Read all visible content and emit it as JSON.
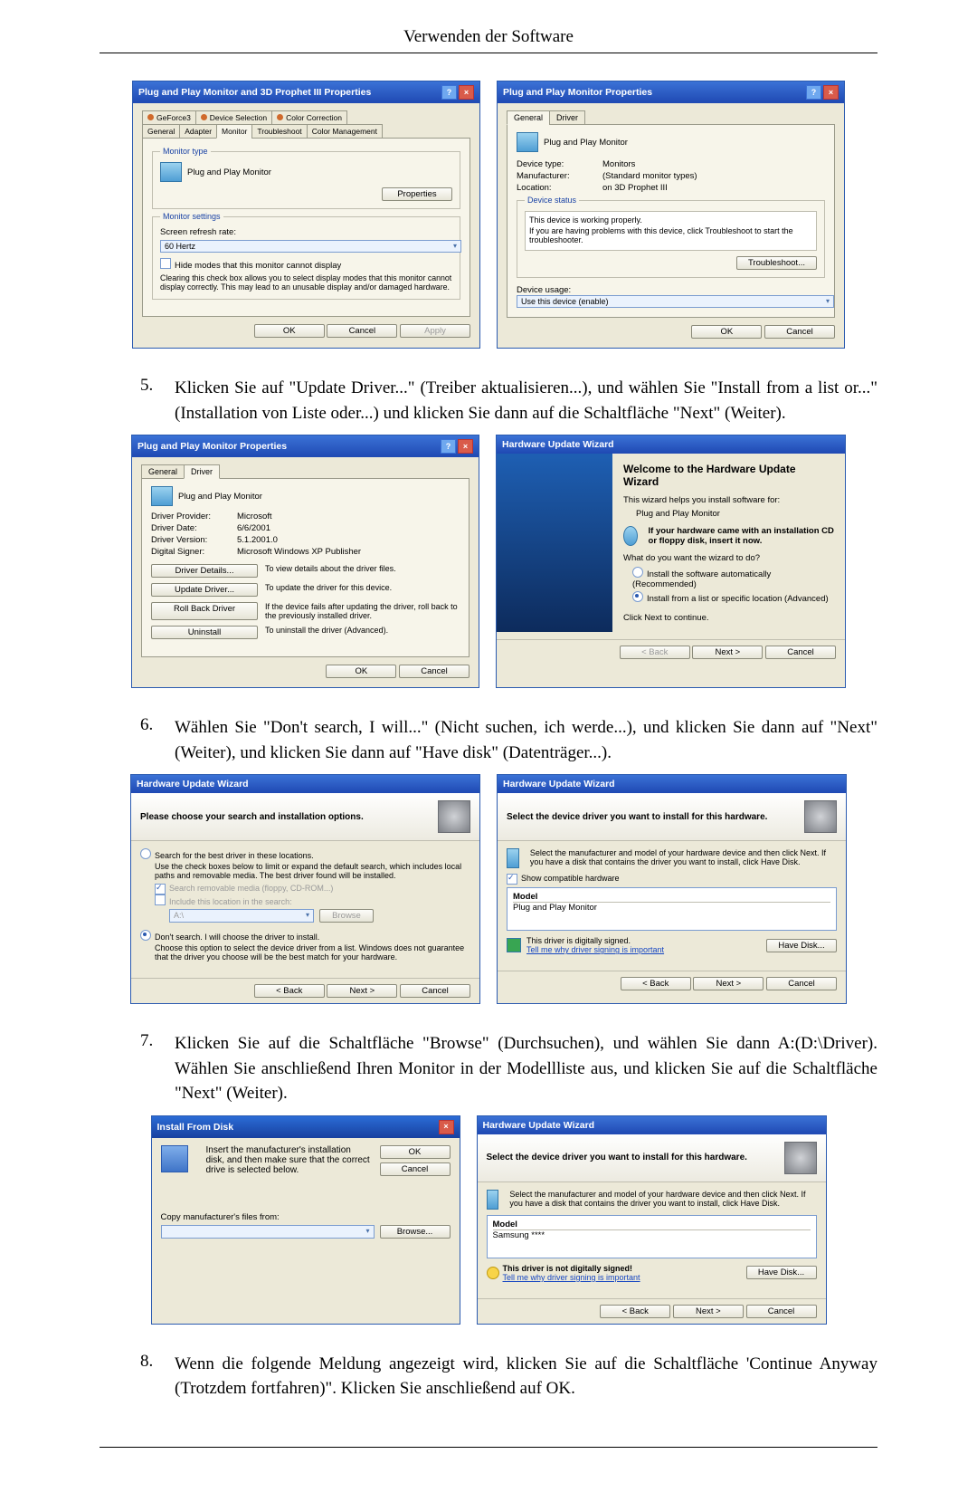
{
  "page": {
    "title": "Verwenden der Software"
  },
  "steps": {
    "s5": {
      "num": "5.",
      "text": "Klicken Sie auf \"Update Driver...\" (Treiber aktualisieren...), und wählen Sie \"Install from a list or...\" (Installation von Liste oder...) und klicken Sie dann auf die Schaltfläche \"Next\" (Weiter)."
    },
    "s6": {
      "num": "6.",
      "text": "Wählen Sie \"Don't search, I will...\" (Nicht suchen, ich werde...), und klicken Sie dann auf \"Next\" (Weiter), und klicken Sie dann auf \"Have disk\" (Datenträger...)."
    },
    "s7": {
      "num": "7.",
      "text": "Klicken Sie auf die Schaltfläche \"Browse\" (Durchsuchen), und wählen Sie dann A:(D:\\Driver). Wählen Sie anschließend Ihren Monitor in der Modellliste aus, und klicken Sie auf die Schaltfläche \"Next\" (Weiter)."
    },
    "s8": {
      "num": "8.",
      "text": "Wenn die folgende Meldung angezeigt wird, klicken Sie auf die Schaltfläche 'Continue Anyway (Trotzdem fortfahren)\". Klicken Sie anschließend auf OK."
    }
  },
  "dlg_adapter": {
    "title": "Plug and Play Monitor and 3D Prophet III Properties",
    "tabs": {
      "geforce": "GeForce3",
      "devsel": "Device Selection",
      "colcor": "Color Correction",
      "general": "General",
      "adapter": "Adapter",
      "monitor": "Monitor",
      "trouble": "Troubleshoot",
      "colman": "Color Management"
    },
    "grp_type": "Monitor type",
    "monitor_name": "Plug and Play Monitor",
    "properties_btn": "Properties",
    "grp_settings": "Monitor settings",
    "refresh_label": "Screen refresh rate:",
    "refresh_value": "60 Hertz",
    "hide_modes": "Hide modes that this monitor cannot display",
    "hide_modes_help": "Clearing this check box allows you to select display modes that this monitor cannot display correctly. This may lead to an unusable display and/or damaged hardware.",
    "ok": "OK",
    "cancel": "Cancel",
    "apply": "Apply"
  },
  "dlg_pnp_general": {
    "title": "Plug and Play Monitor Properties",
    "tab_general": "General",
    "tab_driver": "Driver",
    "header": "Plug and Play Monitor",
    "k_type": "Device type:",
    "v_type": "Monitors",
    "k_mfr": "Manufacturer:",
    "v_mfr": "(Standard monitor types)",
    "k_loc": "Location:",
    "v_loc": "on 3D Prophet III",
    "grp_status": "Device status",
    "status_text": "This device is working properly.",
    "status_help": "If you are having problems with this device, click Troubleshoot to start the troubleshooter.",
    "btn_trouble": "Troubleshoot...",
    "usage_label": "Device usage:",
    "usage_value": "Use this device (enable)",
    "ok": "OK",
    "cancel": "Cancel"
  },
  "dlg_pnp_driver": {
    "title": "Plug and Play Monitor Properties",
    "tab_general": "General",
    "tab_driver": "Driver",
    "header": "Plug and Play Monitor",
    "k_provider": "Driver Provider:",
    "v_provider": "Microsoft",
    "k_date": "Driver Date:",
    "v_date": "6/6/2001",
    "k_ver": "Driver Version:",
    "v_ver": "5.1.2001.0",
    "k_signer": "Digital Signer:",
    "v_signer": "Microsoft Windows XP Publisher",
    "btn_details": "Driver Details...",
    "btn_details_help": "To view details about the driver files.",
    "btn_update": "Update Driver...",
    "btn_update_help": "To update the driver for this device.",
    "btn_rollback": "Roll Back Driver",
    "btn_rollback_help": "If the device fails after updating the driver, roll back to the previously installed driver.",
    "btn_uninstall": "Uninstall",
    "btn_uninstall_help": "To uninstall the driver (Advanced).",
    "ok": "OK",
    "cancel": "Cancel"
  },
  "wiz_welcome": {
    "title": "Hardware Update Wizard",
    "h1": "Welcome to the Hardware Update Wizard",
    "p1": "This wizard helps you install software for:",
    "device": "Plug and Play Monitor",
    "cd_hint": "If your hardware came with an installation CD or floppy disk, insert it now.",
    "q": "What do you want the wizard to do?",
    "opt1": "Install the software automatically (Recommended)",
    "opt2": "Install from a list or specific location (Advanced)",
    "next_hint": "Click Next to continue.",
    "back": "< Back",
    "next": "Next >",
    "cancel": "Cancel"
  },
  "wiz_search": {
    "title": "Hardware Update Wizard",
    "header": "Please choose your search and installation options.",
    "opt_search": "Search for the best driver in these locations.",
    "opt_search_help": "Use the check boxes below to limit or expand the default search, which includes local paths and removable media. The best driver found will be installed.",
    "chk_media": "Search removable media (floppy, CD-ROM...)",
    "chk_include": "Include this location in the search:",
    "path": "A:\\",
    "browse": "Browse",
    "opt_dont": "Don't search. I will choose the driver to install.",
    "opt_dont_help": "Choose this option to select the device driver from a list. Windows does not guarantee that the driver you choose will be the best match for your hardware.",
    "back": "< Back",
    "next": "Next >",
    "cancel": "Cancel"
  },
  "wiz_select": {
    "title": "Hardware Update Wizard",
    "header": "Select the device driver you want to install for this hardware.",
    "hint": "Select the manufacturer and model of your hardware device and then click Next. If you have a disk that contains the driver you want to install, click Have Disk.",
    "chk_compat": "Show compatible hardware",
    "col_model": "Model",
    "model": "Plug and Play Monitor",
    "signed": "This driver is digitally signed.",
    "why_link": "Tell me why driver signing is important",
    "have_disk": "Have Disk...",
    "back": "< Back",
    "next": "Next >",
    "cancel": "Cancel"
  },
  "install_from_disk": {
    "title": "Install From Disk",
    "msg": "Insert the manufacturer's installation disk, and then make sure that the correct drive is selected below.",
    "ok": "OK",
    "cancel": "Cancel",
    "copy_label": "Copy manufacturer's files from:",
    "browse": "Browse..."
  },
  "wiz_select2": {
    "title": "Hardware Update Wizard",
    "header": "Select the device driver you want to install for this hardware.",
    "hint": "Select the manufacturer and model of your hardware device and then click Next. If you have a disk that contains the driver you want to install, click Have Disk.",
    "col_model": "Model",
    "model": "Samsung ****",
    "not_signed": "This driver is not digitally signed!",
    "why_link": "Tell me why driver signing is important",
    "have_disk": "Have Disk...",
    "back": "< Back",
    "next": "Next >",
    "cancel": "Cancel"
  }
}
